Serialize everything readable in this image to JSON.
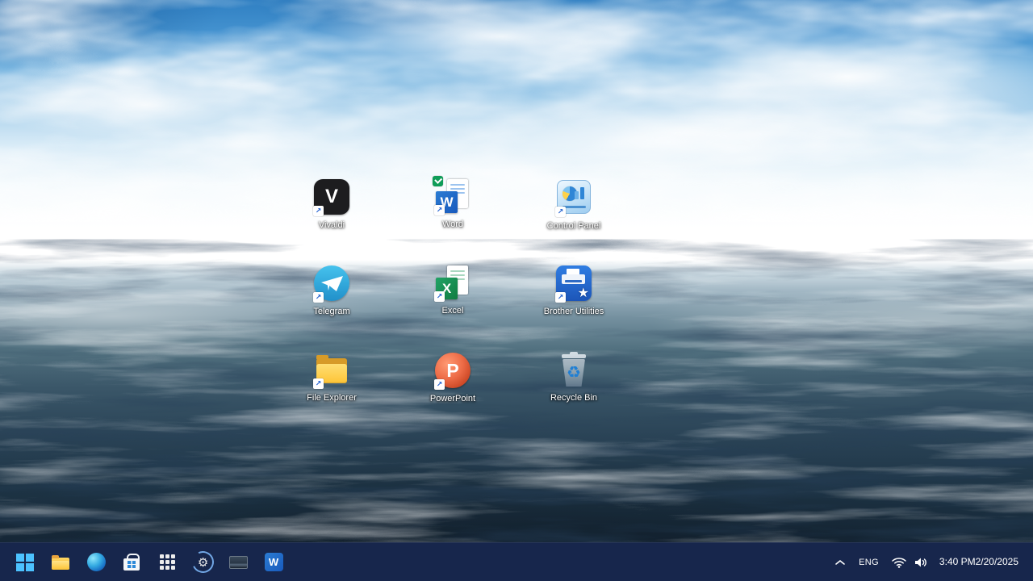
{
  "glyphs": {
    "gear": "⚙",
    "star": "★",
    "recycle": "♻",
    "shortcut_arrow": "↗"
  },
  "desktop": {
    "icons": [
      {
        "name": "vivaldi",
        "label": "Vivaldi",
        "letter": "V",
        "shortcut": true
      },
      {
        "name": "word",
        "label": "Word",
        "letter": "W",
        "shortcut": true
      },
      {
        "name": "control-panel",
        "label": "Control Panel",
        "shortcut": true
      },
      {
        "name": "telegram",
        "label": "Telegram",
        "shortcut": true
      },
      {
        "name": "excel",
        "label": "Excel",
        "letter": "X",
        "shortcut": true
      },
      {
        "name": "brother-utilities",
        "label": "Brother Utilities",
        "shortcut": true
      },
      {
        "name": "file-explorer",
        "label": "File Explorer",
        "shortcut": true
      },
      {
        "name": "powerpoint",
        "label": "PowerPoint",
        "letter": "P",
        "shortcut": true
      },
      {
        "name": "recycle-bin",
        "label": "Recycle Bin",
        "shortcut": false
      }
    ]
  },
  "taskbar": {
    "pinned": [
      {
        "name": "start"
      },
      {
        "name": "file-explorer"
      },
      {
        "name": "edge"
      },
      {
        "name": "microsoft-store"
      },
      {
        "name": "app-grid"
      },
      {
        "name": "settings"
      },
      {
        "name": "photos"
      },
      {
        "name": "word",
        "letter": "W"
      }
    ],
    "tray": {
      "language": "ENG",
      "time": "3:40 PM",
      "date": "2/20/2025"
    }
  },
  "colors": {
    "taskbar": "#17264c",
    "accent_blue": "#4cc2ff",
    "word_blue": "#185abd",
    "excel_green": "#107c41",
    "powerpoint_red": "#c43e1c",
    "telegram_blue": "#2ca0d8",
    "folder_yellow": "#fdc436"
  }
}
